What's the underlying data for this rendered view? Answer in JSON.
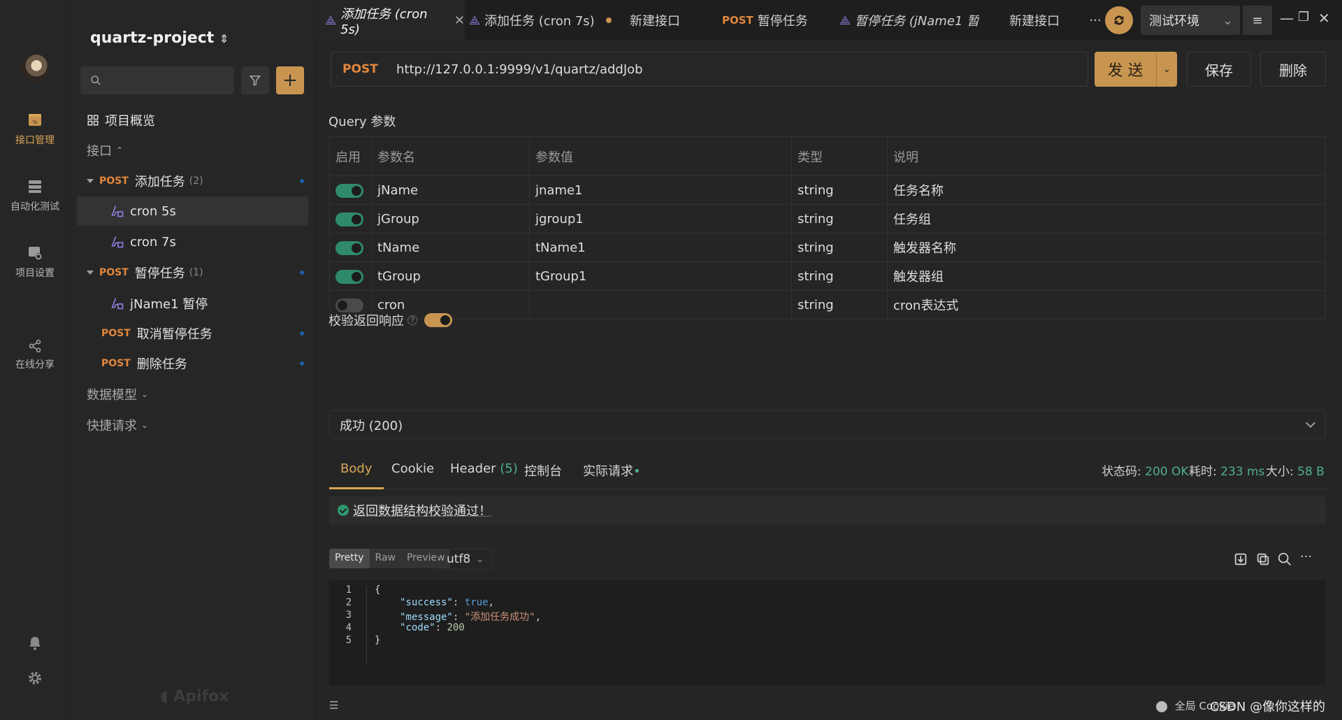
{
  "rail": {
    "items": [
      {
        "label": "接口管理",
        "icon": "api-management-icon"
      },
      {
        "label": "自动化测试",
        "icon": "automation-test-icon"
      },
      {
        "label": "项目设置",
        "icon": "project-settings-icon"
      },
      {
        "label": "在线分享",
        "icon": "share-icon"
      }
    ]
  },
  "sidebar": {
    "project": "quartz-project",
    "overview": "项目概览",
    "api_section": "接口",
    "tree": [
      {
        "method": "POST",
        "label": "添加任务",
        "count": "(2)"
      },
      {
        "label": "cron 5s"
      },
      {
        "label": "cron 7s"
      },
      {
        "method": "POST",
        "label": "暂停任务",
        "count": "(1)"
      },
      {
        "label": "jName1 暂停"
      },
      {
        "method": "POST",
        "label": "取消暂停任务"
      },
      {
        "method": "POST",
        "label": "删除任务"
      }
    ],
    "data_models": "数据模型",
    "quick_request": "快捷请求",
    "brand": "Apifox"
  },
  "tabs": [
    {
      "label": "添加任务 (cron 5s)"
    },
    {
      "label": "添加任务 (cron 7s)"
    },
    {
      "label": "新建接口"
    },
    {
      "method": "POST",
      "label": "暂停任务"
    },
    {
      "label": "暂停任务 (jName1 暂..."
    },
    {
      "label": "新建接口"
    }
  ],
  "env": "测试环境",
  "request": {
    "method": "POST",
    "url": "http://127.0.0.1:9999/v1/quartz/addJob",
    "send": "发 送",
    "save": "保存",
    "delete": "删除"
  },
  "query": {
    "title": "Query 参数",
    "headers": [
      "启用",
      "参数名",
      "参数值",
      "类型",
      "说明"
    ],
    "rows": [
      {
        "enabled": true,
        "name": "jName",
        "value": "jname1",
        "type": "string",
        "desc": "任务名称"
      },
      {
        "enabled": true,
        "name": "jGroup",
        "value": "jgroup1",
        "type": "string",
        "desc": "任务组"
      },
      {
        "enabled": true,
        "name": "tName",
        "value": "tName1",
        "type": "string",
        "desc": "触发器名称"
      },
      {
        "enabled": true,
        "name": "tGroup",
        "value": "tGroup1",
        "type": "string",
        "desc": "触发器组"
      },
      {
        "enabled": false,
        "name": "cron",
        "value": "",
        "type": "string",
        "desc": "cron表达式"
      }
    ]
  },
  "validate": {
    "label": "校验返回响应",
    "selected": "成功 (200)"
  },
  "response": {
    "tabs": [
      "Body",
      "Cookie",
      "Header",
      "控制台",
      "实际请求"
    ],
    "header_count": "(5)",
    "status_label": "状态码:",
    "status": "200 OK",
    "time_label": "耗时:",
    "time": "233 ms",
    "size_label": "大小:",
    "size": "58 B",
    "check_msg": "返回数据结构校验通过！",
    "views": [
      "Pretty",
      "Raw",
      "Preview"
    ],
    "encoding": "utf8",
    "lines": [
      "1",
      "2",
      "3",
      "4",
      "5"
    ],
    "json": {
      "open": "{",
      "success_key": "\"success\"",
      "success_val": "true",
      "message_key": "\"message\"",
      "message_val": "\"添加任务成功\"",
      "code_key": "\"code\"",
      "code_val": "200",
      "close": "}"
    }
  },
  "footer": {
    "cookie": "全局 Cookie",
    "watermark": "CSDN @像你这样的"
  },
  "colors": {
    "accent": "#c89550",
    "method": "#e1873c",
    "success": "#4fb08a"
  }
}
